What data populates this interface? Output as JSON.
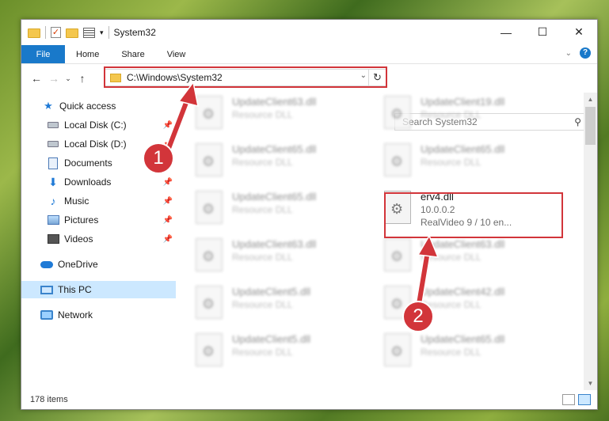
{
  "window": {
    "title": "System32"
  },
  "ribbon": {
    "tabs": [
      "File",
      "Home",
      "Share",
      "View"
    ]
  },
  "nav": {
    "address": "C:\\Windows\\System32",
    "search_placeholder": "Search System32"
  },
  "sidebar": {
    "items": [
      {
        "label": "Quick access",
        "icon": "star-icon",
        "pinned": false
      },
      {
        "label": "Local Disk (C:)",
        "icon": "drive-icon",
        "pinned": true
      },
      {
        "label": "Local Disk (D:)",
        "icon": "drive-icon",
        "pinned": true
      },
      {
        "label": "Documents",
        "icon": "documents-icon",
        "pinned": true
      },
      {
        "label": "Downloads",
        "icon": "downloads-icon",
        "pinned": true
      },
      {
        "label": "Music",
        "icon": "music-icon",
        "pinned": true
      },
      {
        "label": "Pictures",
        "icon": "pictures-icon",
        "pinned": true
      },
      {
        "label": "Videos",
        "icon": "videos-icon",
        "pinned": true
      },
      {
        "label": "OneDrive",
        "icon": "onedrive-icon",
        "pinned": false
      },
      {
        "label": "This PC",
        "icon": "computer-icon",
        "pinned": false,
        "selected": true
      },
      {
        "label": "Network",
        "icon": "network-icon",
        "pinned": false
      }
    ]
  },
  "files": [
    {
      "name": "UpdateClient63.dll",
      "sub": "Resource DLL",
      "blurred": true
    },
    {
      "name": "UpdateClient19.dll",
      "sub": "Resource DLL",
      "blurred": true
    },
    {
      "name": "UpdateClient65.dll",
      "sub": "Resource DLL",
      "blurred": true
    },
    {
      "name": "UpdateClient65.dll",
      "sub": "Resource DLL",
      "blurred": true
    },
    {
      "name": "UpdateClient65.dll",
      "sub": "Resource DLL",
      "blurred": true
    },
    {
      "name": "erv4.dll",
      "sub": "10.0.0.2",
      "sub2": "RealVideo 9 / 10 en...",
      "blurred": false
    },
    {
      "name": "UpdateClient63.dll",
      "sub": "Resource DLL",
      "blurred": true
    },
    {
      "name": "UpdateClient63.dll",
      "sub": "Resource DLL",
      "blurred": true
    },
    {
      "name": "UpdateClient5.dll",
      "sub": "Resource DLL",
      "blurred": true
    },
    {
      "name": "UpdateClient42.dll",
      "sub": "Resource DLL",
      "blurred": true
    },
    {
      "name": "UpdateClient5.dll",
      "sub": "Resource DLL",
      "blurred": true
    },
    {
      "name": "UpdateClient65.dll",
      "sub": "Resource DLL",
      "blurred": true
    }
  ],
  "status": {
    "item_count": "178 items"
  },
  "annotations": {
    "step1": "1",
    "step2": "2",
    "color": "#d2353a"
  }
}
